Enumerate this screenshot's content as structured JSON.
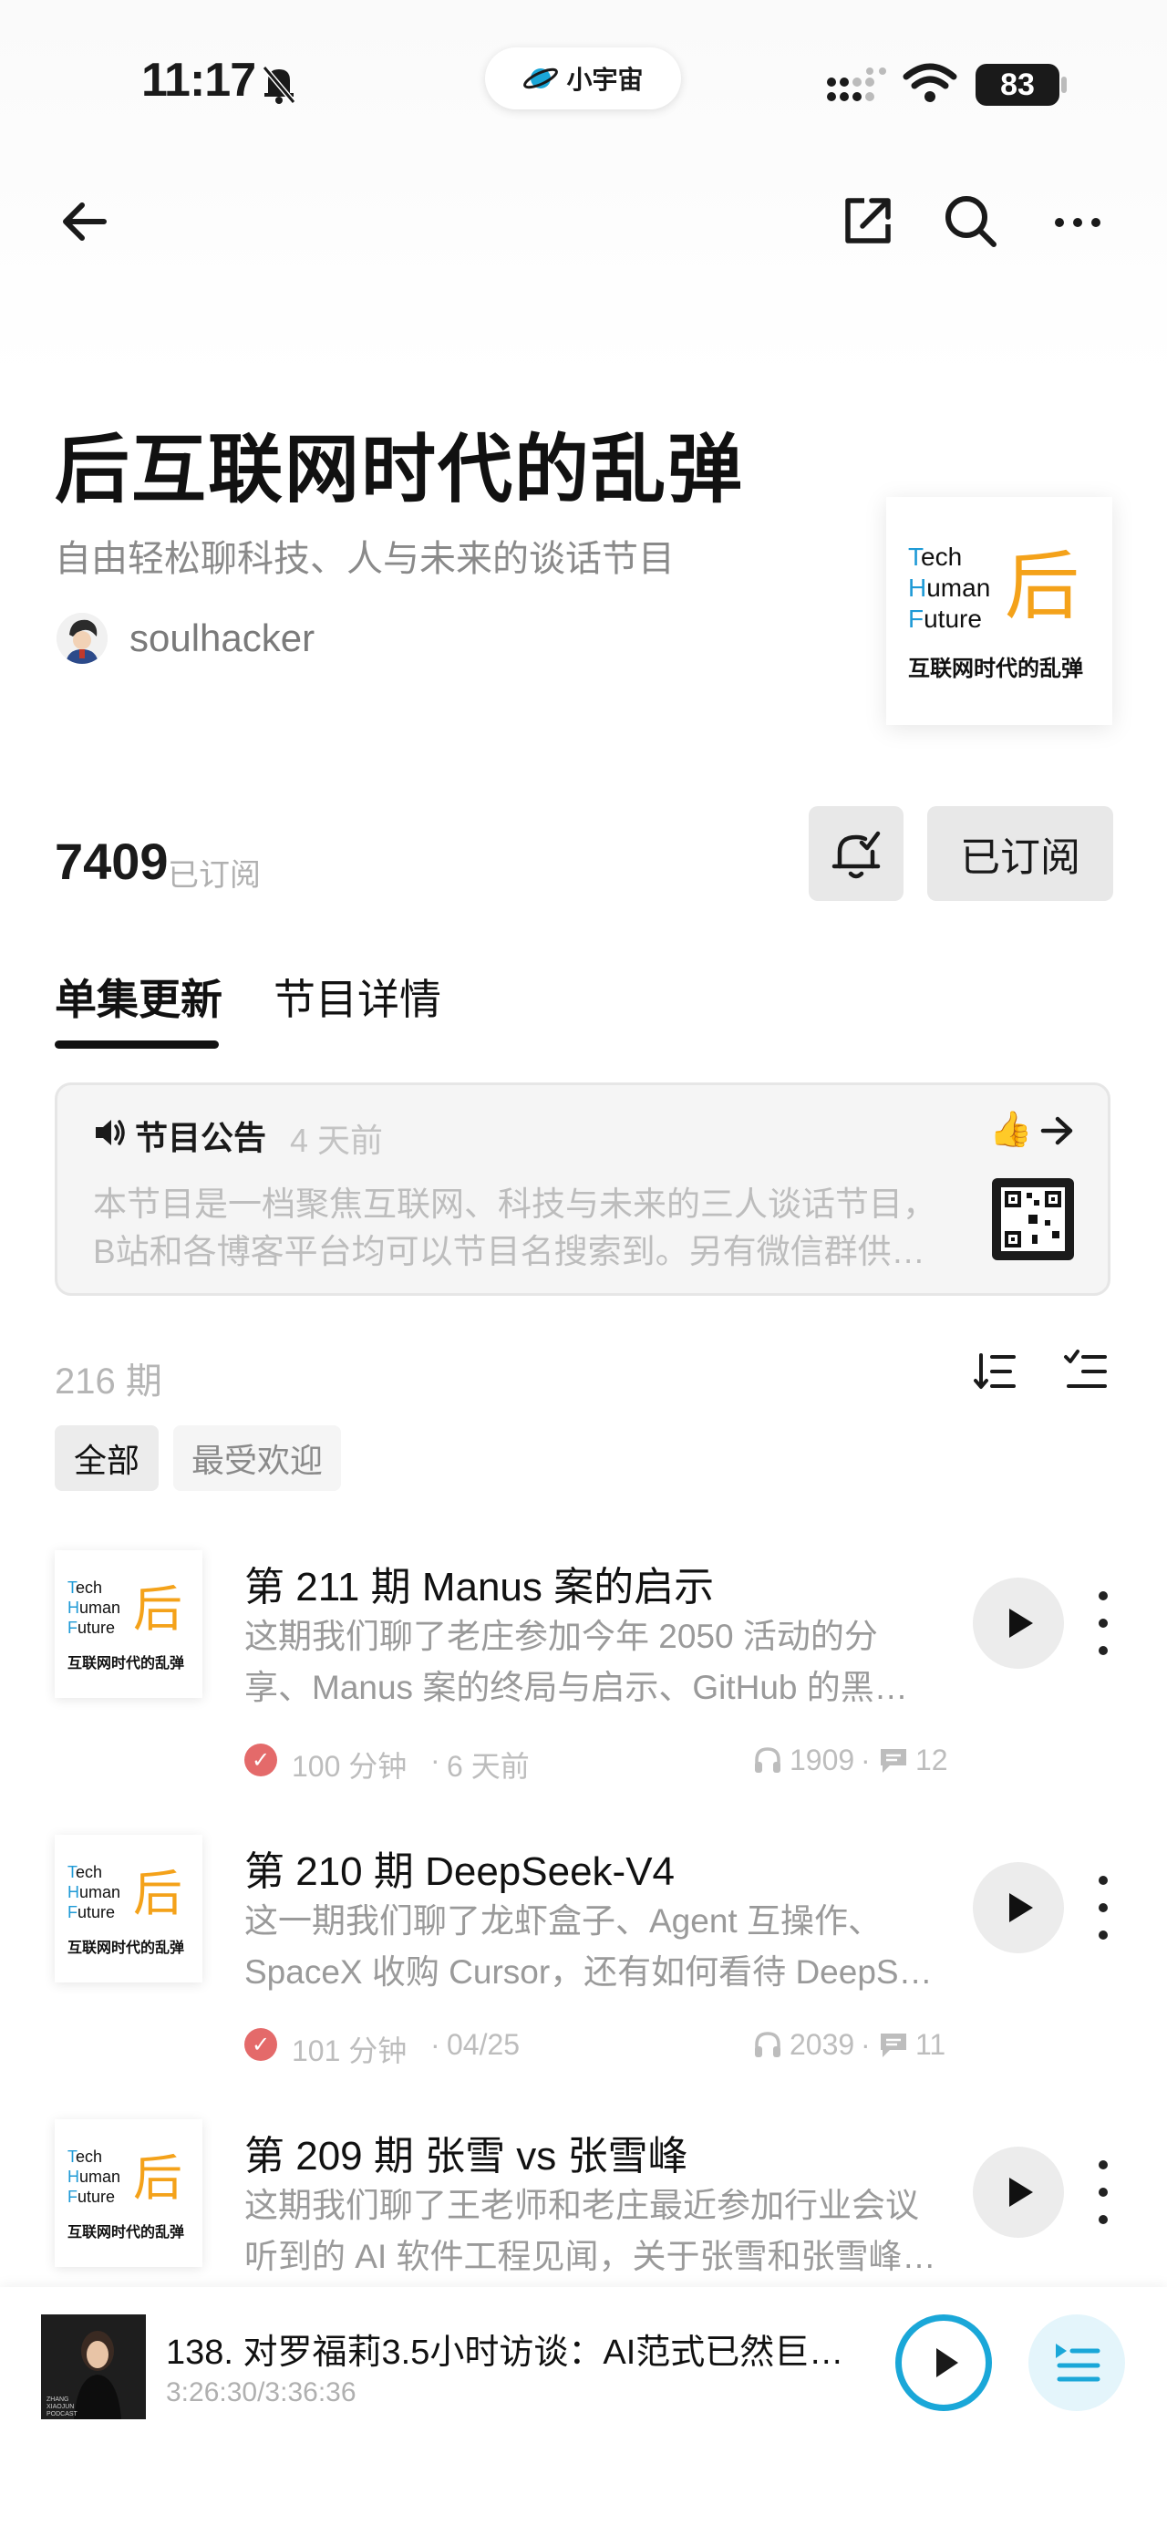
{
  "status_bar": {
    "time": "11:17",
    "app_name": "小宇宙",
    "battery": "83"
  },
  "nav": {
    "back_icon": "arrow-left-icon",
    "share_icon": "share-icon",
    "search_icon": "search-icon",
    "more_icon": "more-horizontal-icon"
  },
  "podcast": {
    "title": "后互联网时代的乱弹",
    "subtitle": "自由轻松聊科技、人与未来的谈话节目",
    "host": "soulhacker",
    "cover": {
      "line1_initial": "T",
      "line1_rest": "ech",
      "line2_initial": "H",
      "line2_rest": "uman",
      "line3_initial": "F",
      "line3_rest": "uture",
      "glyph": "后",
      "caption": "互联网时代的乱弹"
    },
    "subscribers": "7409",
    "subscribers_label": "已订阅",
    "subscribed_button": "已订阅"
  },
  "tabs": [
    {
      "label": "单集更新",
      "active": true
    },
    {
      "label": "节目详情",
      "active": false
    }
  ],
  "announcement": {
    "title": "节目公告",
    "time": "4 天前",
    "line1": "本节目是一档聚焦互联网、科技与未来的三人谈话节目，",
    "line2": "B站和各博客平台均可以节目名搜索到。另有微信群供…",
    "emoji": "👍"
  },
  "episodes_header": {
    "count": "216 期",
    "filters": [
      "全部",
      "最受欢迎"
    ]
  },
  "episodes": [
    {
      "title": "第 211 期 Manus 案的启示",
      "desc1": "这期我们聊了老庄参加今年 2050 活动的分",
      "desc2": "享、Manus 案的终局与启示、GitHub 的黑…",
      "duration": "100 分钟",
      "date": "6 天前",
      "plays": "1909",
      "comments": "12"
    },
    {
      "title": "第 210 期 DeepSeek-V4",
      "desc1": "这一期我们聊了龙虾盒子、Agent 互操作、",
      "desc2": "SpaceX 收购 Cursor，还有如何看待 DeepS…",
      "duration": "101 分钟",
      "date": "04/25",
      "plays": "2039",
      "comments": "11"
    },
    {
      "title": "第 209 期 张雪 vs 张雪峰",
      "desc1": "这期我们聊了王老师和老庄最近参加行业会议",
      "desc2": "听到的 AI 软件工程见闻，关于张雪和张雪峰…"
    }
  ],
  "mini_player": {
    "title": "138. 对罗福莉3.5小时访谈：AI范式已然巨变…",
    "time": "3:26:30/3:36:36",
    "cover_text": "ZHANG XIAOJUN PODCAST"
  },
  "colors": {
    "accent_blue": "#1aa7d8",
    "cover_orange": "#f4a21a",
    "cover_blue": "#1e9ad6",
    "played_red": "#e46a6a"
  }
}
